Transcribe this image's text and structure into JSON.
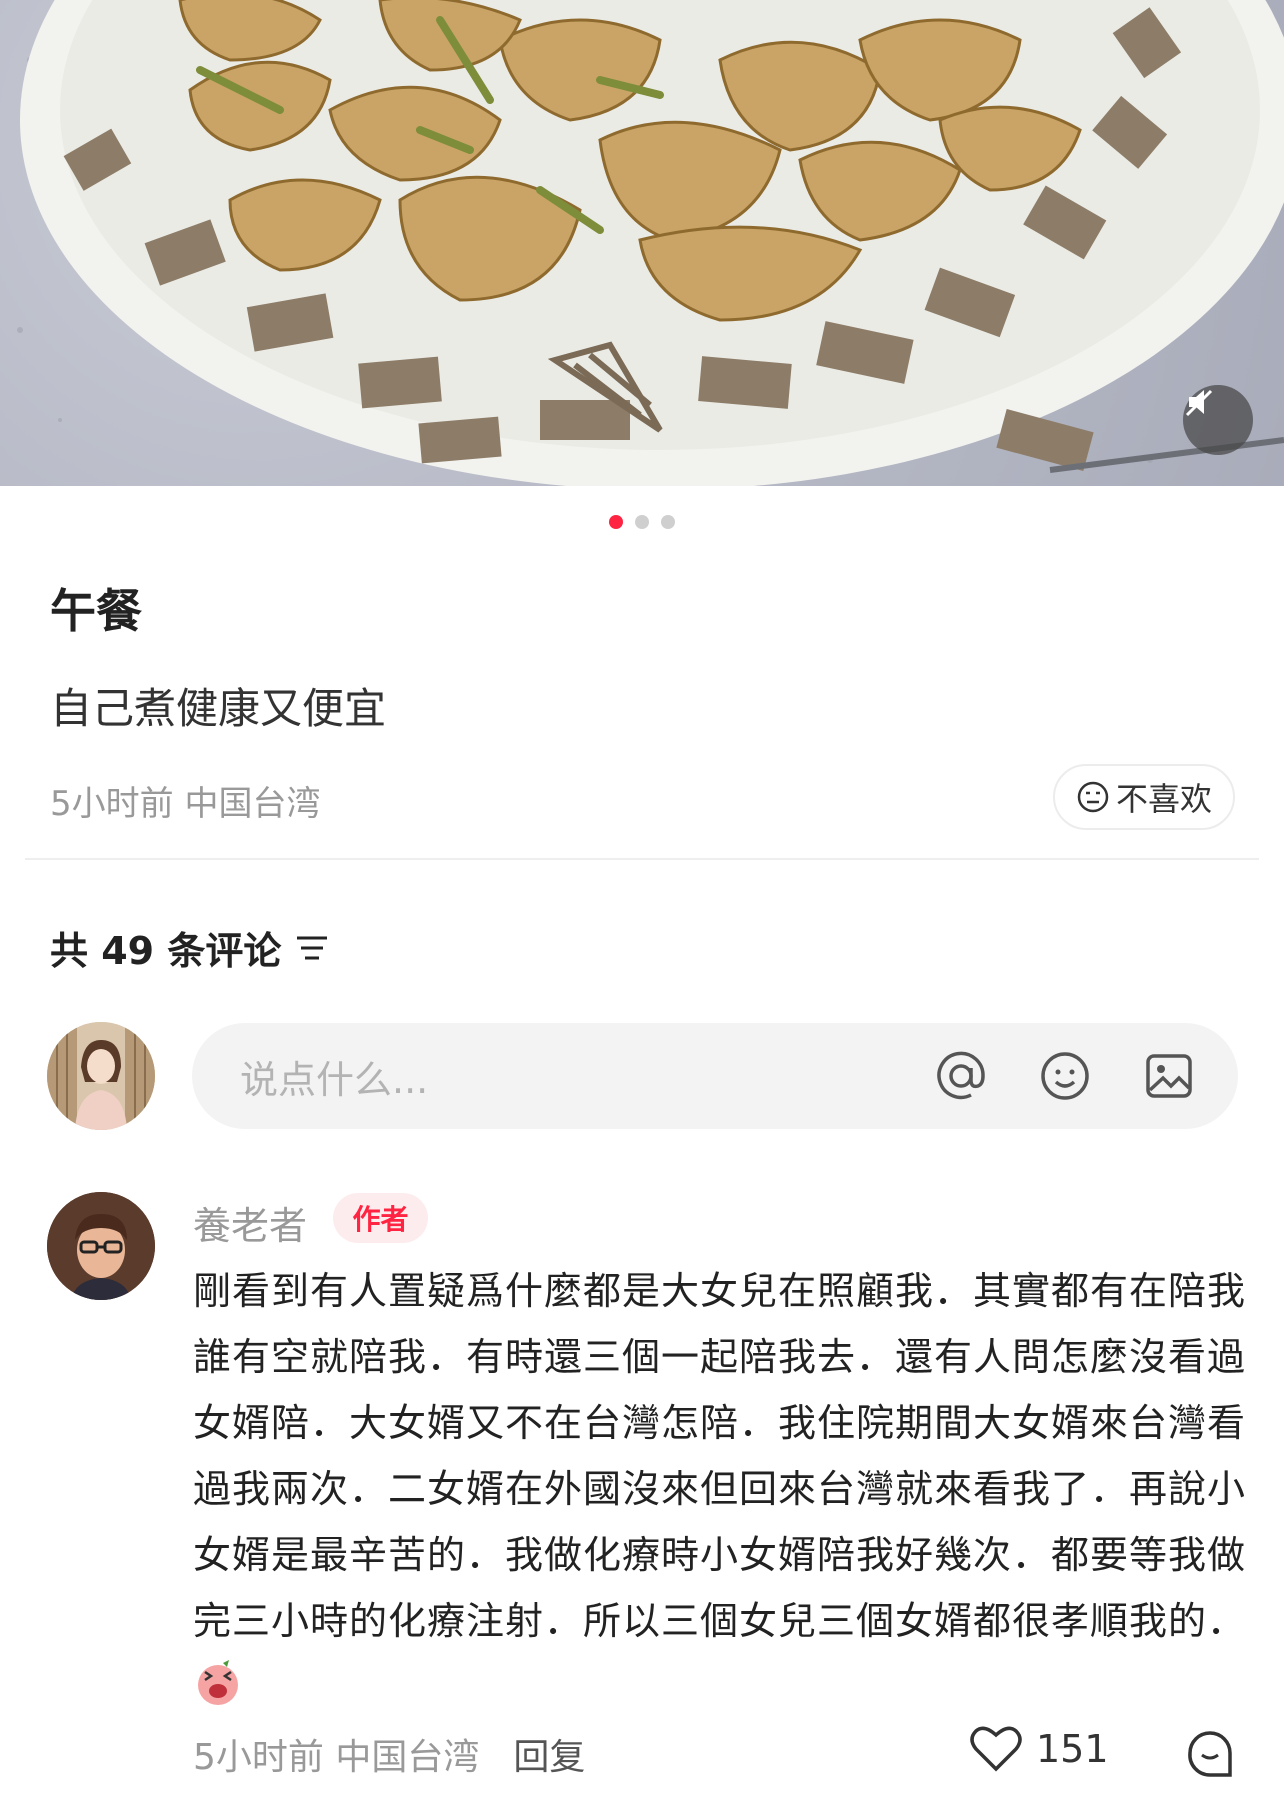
{
  "post": {
    "title": "午餐",
    "description": "自己煮健康又便宜",
    "time": "5小时前",
    "location": "中国台湾",
    "dislike_label": "不喜欢",
    "image_count": 3,
    "active_image": 1
  },
  "comments_header": {
    "label": "共 49 条评论"
  },
  "input": {
    "placeholder": "说点什么..."
  },
  "author_comment": {
    "name": "養老者",
    "badge": "作者",
    "text": "剛看到有人置疑爲什麼都是大女兒在照顧我．其實都有在陪我誰有空就陪我．有時還三個一起陪我去．還有人問怎麼沒看過女婿陪．大女婿又不在台灣怎陪．我住院期間大女婿來台灣看過我兩次．二女婿在外國沒來但回來台灣就來看我了．再說小女婿是最辛苦的．我做化療時小女婿陪我好幾次．都要等我做完三小時的化療注射．所以三個女兒三個女婿都很孝順我的．",
    "time": "5小时前",
    "location": "中国台湾",
    "reply_label": "回复",
    "likes": "151"
  },
  "colors": {
    "accent": "#ff2442",
    "muted": "#999999"
  }
}
